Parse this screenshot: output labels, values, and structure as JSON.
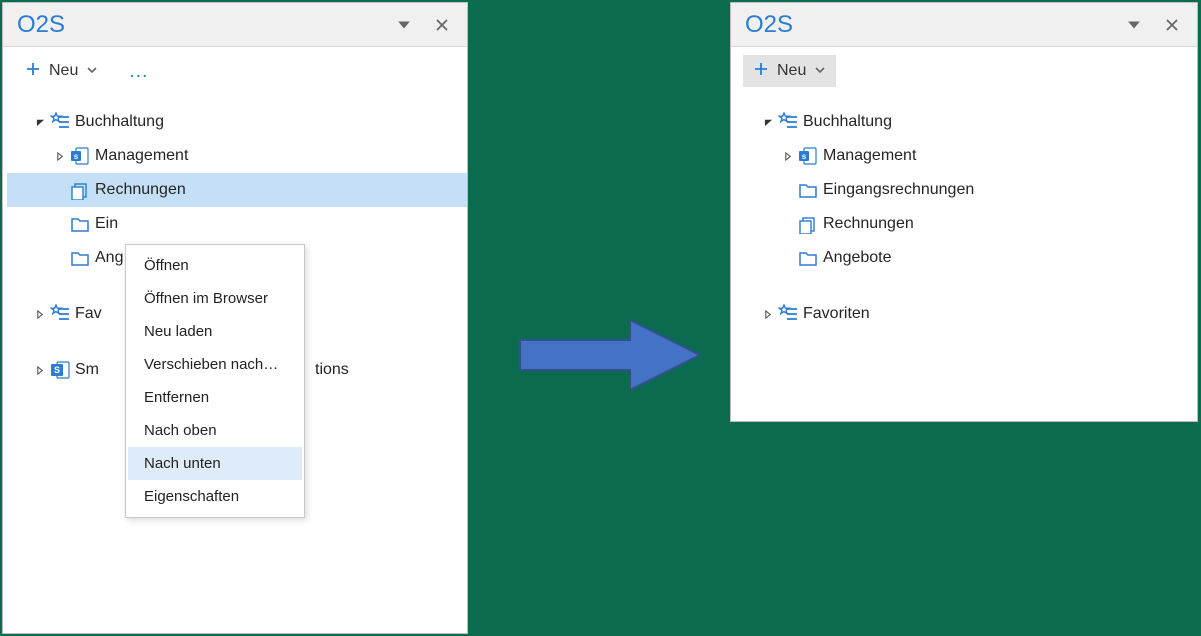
{
  "brand": "O2S",
  "toolbar": {
    "new_label": "Neu",
    "more_label": "…"
  },
  "ctxmenu": {
    "items": [
      "Öffnen",
      "Öffnen im Browser",
      "Neu laden",
      "Verschieben nach…",
      "Entfernen",
      "Nach oben",
      "Nach unten",
      "Eigenschaften"
    ],
    "hover_index": 6
  },
  "left_tree": {
    "nodes": [
      {
        "label": "Buchhaltung",
        "icon": "favstar",
        "twisty": "open",
        "indent": 1
      },
      {
        "label": "Management",
        "icon": "sp",
        "twisty": "closed",
        "indent": 2
      },
      {
        "label": "Rechnungen",
        "icon": "library",
        "twisty": "",
        "indent": 2,
        "selected": true
      },
      {
        "label": "Ein",
        "icon": "folder",
        "twisty": "",
        "indent": 2,
        "cut": true
      },
      {
        "label": "Ang",
        "icon": "folder",
        "twisty": "",
        "indent": 2,
        "cut": true
      }
    ],
    "nodes2": [
      {
        "label": "Fav",
        "icon": "favstar",
        "twisty": "closed",
        "indent": 1,
        "cut": true
      }
    ],
    "nodes3": [
      {
        "label": "Sm",
        "icon": "splogo",
        "twisty": "closed",
        "indent": 1,
        "cut": true,
        "suffix": "tions"
      }
    ]
  },
  "right_tree": {
    "nodes": [
      {
        "label": "Buchhaltung",
        "icon": "favstar",
        "twisty": "open",
        "indent": 1
      },
      {
        "label": "Management",
        "icon": "sp",
        "twisty": "closed",
        "indent": 2
      },
      {
        "label": "Eingangsrechnungen",
        "icon": "folder",
        "twisty": "",
        "indent": 2
      },
      {
        "label": "Rechnungen",
        "icon": "library",
        "twisty": "",
        "indent": 2
      },
      {
        "label": "Angebote",
        "icon": "folder",
        "twisty": "",
        "indent": 2
      }
    ],
    "nodes2": [
      {
        "label": "Favoriten",
        "icon": "favstar",
        "twisty": "closed",
        "indent": 1
      }
    ]
  }
}
